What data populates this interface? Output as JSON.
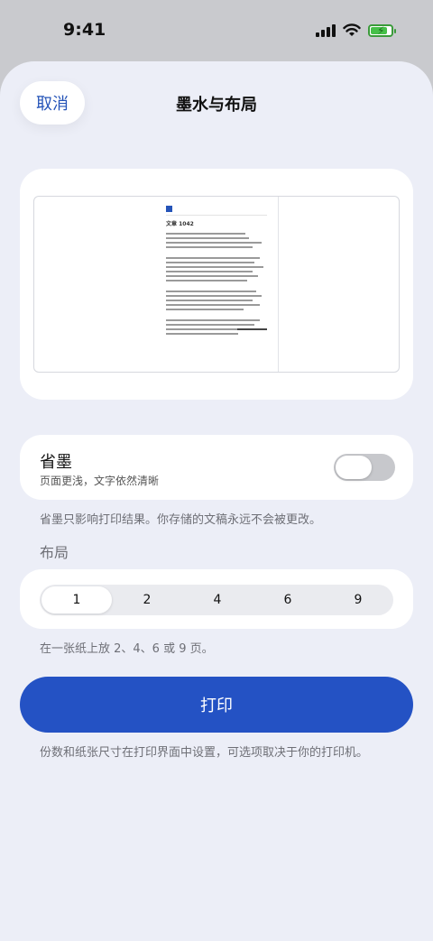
{
  "status_bar": {
    "time": "9:41"
  },
  "header": {
    "cancel_label": "取消",
    "title": "墨水与布局"
  },
  "preview": {
    "doc_title": "文章 1042",
    "accent_color": "#2554b8"
  },
  "ink_saver": {
    "title": "省墨",
    "subtitle": "页面更浅，文字依然清晰",
    "enabled": false,
    "note": "省墨只影响打印结果。你存储的文稿永远不会被更改。"
  },
  "layout": {
    "section_label": "布局",
    "options": [
      "1",
      "2",
      "4",
      "6",
      "9"
    ],
    "selected": "1",
    "note": "在一张纸上放 2、4、6 或 9 页。"
  },
  "print": {
    "button_label": "打印",
    "note": "份数和纸张尺寸在打印界面中设置，可选项取决于你的打印机。",
    "button_color": "#2452c4"
  }
}
